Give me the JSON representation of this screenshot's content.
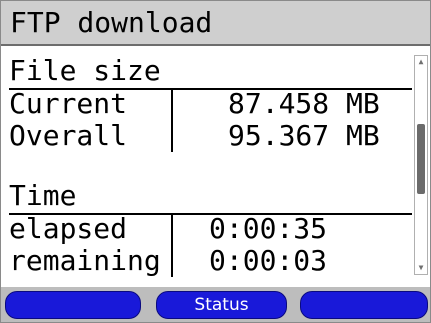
{
  "window": {
    "title": "FTP download"
  },
  "file_size": {
    "heading": "File size",
    "rows": [
      {
        "label": "Current",
        "value": "87.458 MB"
      },
      {
        "label": "Overall",
        "value": "95.367 MB"
      }
    ]
  },
  "time": {
    "heading": "Time",
    "rows": [
      {
        "label": "elapsed",
        "value": "0:00:35"
      },
      {
        "label": "remaining",
        "value": "0:00:03"
      }
    ]
  },
  "softkeys": {
    "left": "",
    "center": "Status",
    "right": ""
  },
  "scrollbar": {
    "up_icon": "triangle-up",
    "down_icon": "triangle-down",
    "position_fraction": 0.45
  },
  "colors": {
    "title_bg": "#cfcfcf",
    "softkey_bg": "#1919d9",
    "softkey_bar": "#bdbdbd"
  }
}
